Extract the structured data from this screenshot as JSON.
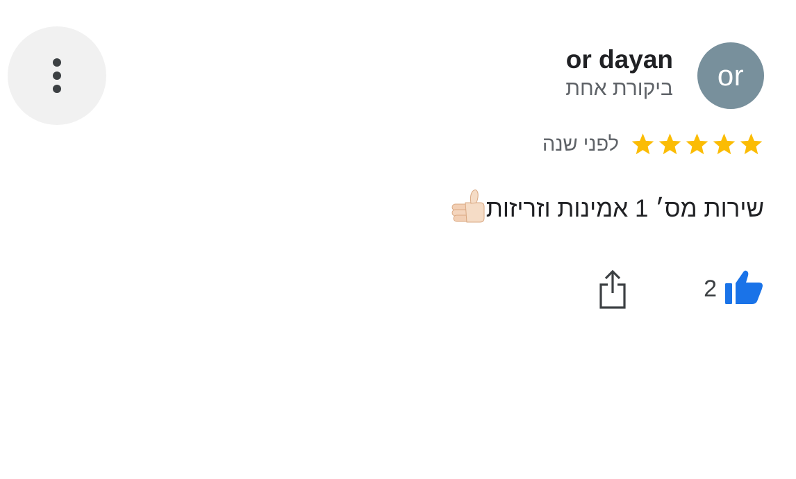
{
  "review": {
    "reviewer": {
      "initials": "or",
      "name": "or dayan",
      "review_count": "ביקורת אחת",
      "avatar_color": "#78909c"
    },
    "rating": {
      "stars": 5,
      "max_stars": 5,
      "star_color": "#fbbc04"
    },
    "time_ago": "לפני שנה",
    "text": "שירות מס׳ 1 אמינות וזריזות",
    "text_emoji": "thumbs-up-emoji"
  },
  "actions": {
    "like_count": "2",
    "like_icon": "thumbs-up-icon",
    "like_color": "#1a73e8",
    "share_icon": "share-icon",
    "menu_icon": "more-vert-icon"
  }
}
